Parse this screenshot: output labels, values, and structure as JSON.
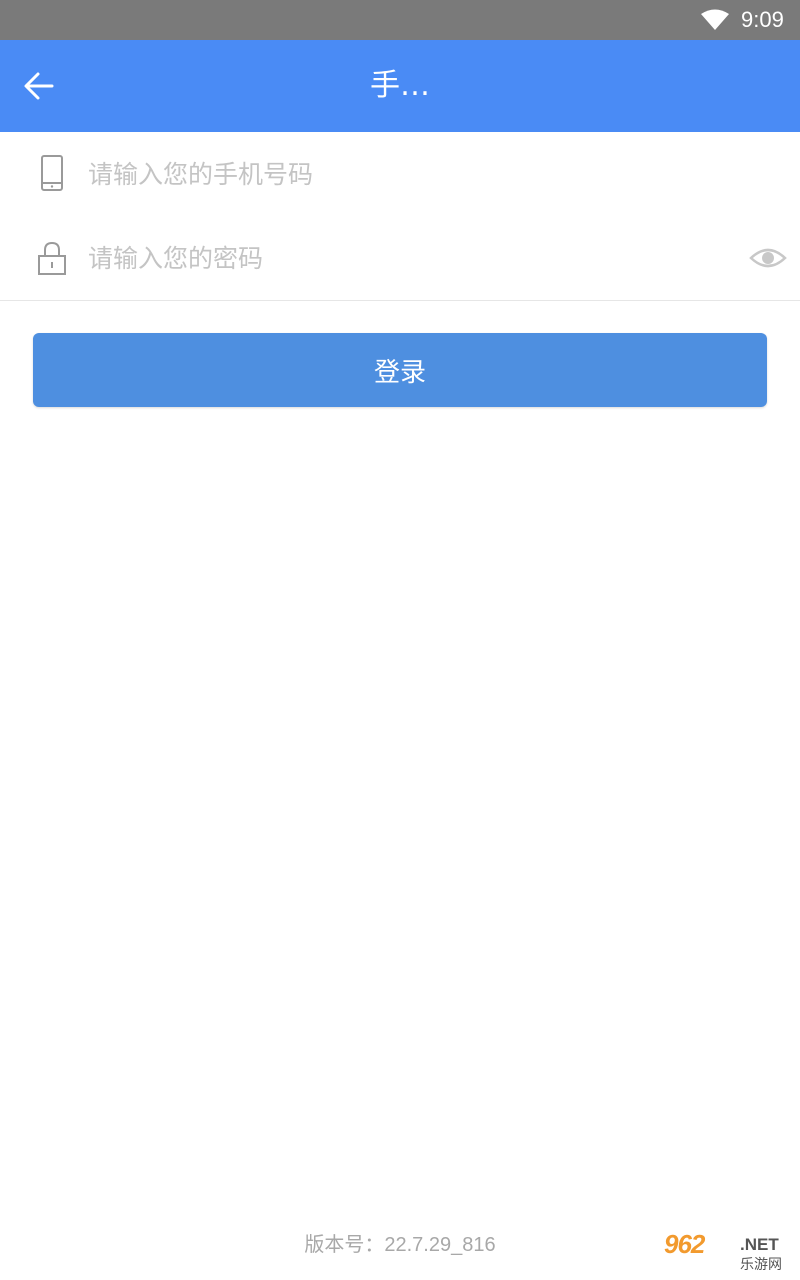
{
  "status_bar": {
    "time": "9:09",
    "wifi_icon": "wifi-icon"
  },
  "app_bar": {
    "title": "手…",
    "back_icon": "arrow-left-icon"
  },
  "phone_field": {
    "icon": "mobile-phone-icon",
    "placeholder": "请输入您的手机号码",
    "value": ""
  },
  "password_field": {
    "icon": "lock-icon",
    "placeholder": "请输入您的密码",
    "value": "",
    "toggle_icon": "eye-icon"
  },
  "login_button": {
    "label": "登录"
  },
  "footer": {
    "version": "版本号：22.7.29_816"
  },
  "watermark": {
    "brand": "962",
    "suffix": ".NET",
    "subtitle": "乐游网"
  },
  "colors": {
    "app_bar": "#4a8bf5",
    "status_bar": "#7a7a7a",
    "login_button": "#4e8fe0",
    "placeholder": "#c4c4c4",
    "version_text": "#a8a8a8"
  }
}
